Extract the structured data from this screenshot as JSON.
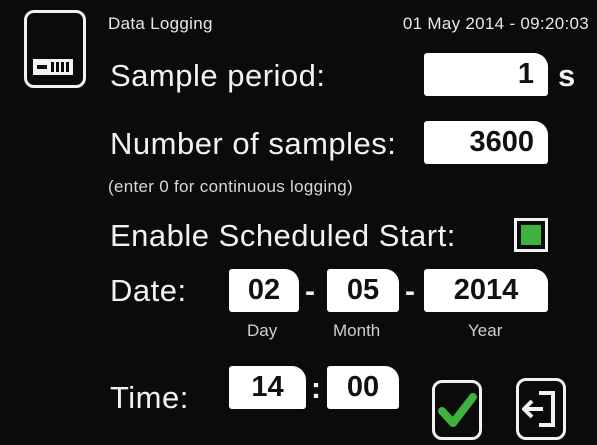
{
  "header": {
    "title": "Data Logging",
    "datetime": "01 May 2014 - 09:20:03"
  },
  "icons": {
    "sd_card": "sd-card-icon",
    "confirm": "checkmark-icon",
    "exit": "exit-icon"
  },
  "colors": {
    "background": "#0b0b0b",
    "accent": "#3db33d",
    "field": "#ffffff"
  },
  "sample_period": {
    "label": "Sample period:",
    "value": "1",
    "unit": "s"
  },
  "num_samples": {
    "label": "Number of samples:",
    "value": "3600",
    "hint": "(enter 0 for continuous logging)"
  },
  "scheduled_start": {
    "label": "Enable Scheduled Start:",
    "checked": true
  },
  "date": {
    "label": "Date:",
    "day": "02",
    "month": "05",
    "year": "2014",
    "separator": "-",
    "day_caption": "Day",
    "month_caption": "Month",
    "year_caption": "Year"
  },
  "time": {
    "label": "Time:",
    "hour": "14",
    "minute": "00",
    "separator": ":"
  }
}
